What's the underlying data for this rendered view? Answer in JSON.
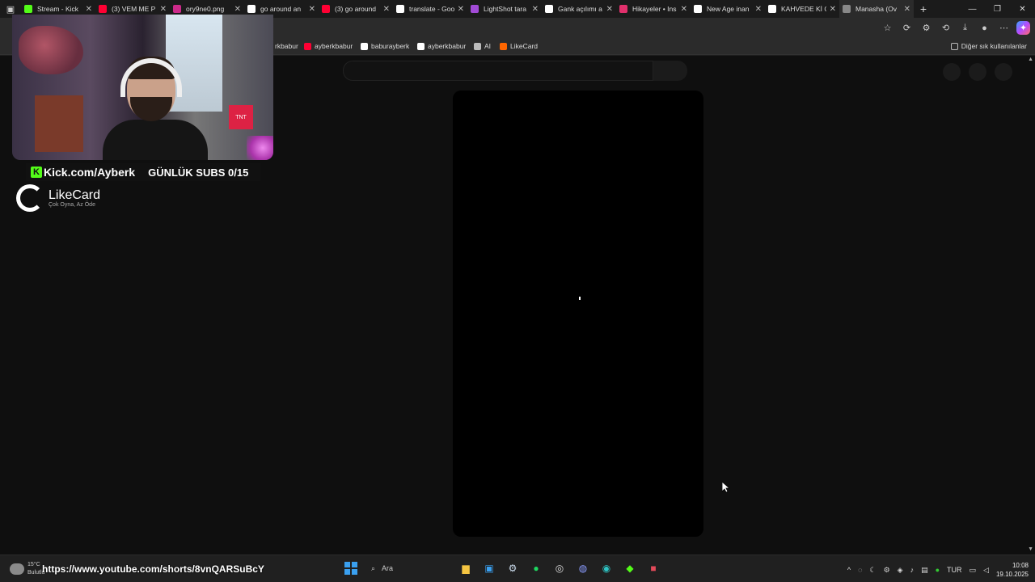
{
  "tabs": [
    {
      "label": "Stream - Kick",
      "color": "#53fc18",
      "icon": "kick-icon"
    },
    {
      "label": "(3) VEM ME P",
      "color": "#ff0033",
      "icon": "youtube-icon"
    },
    {
      "label": "ory9ne0.png",
      "color": "#cc2a8a",
      "icon": "lightshot-icon"
    },
    {
      "label": "go around an",
      "color": "#ffffff",
      "icon": "google-icon"
    },
    {
      "label": "(3) go around",
      "color": "#ff0033",
      "icon": "youtube-icon"
    },
    {
      "label": "translate - Goo",
      "color": "#ffffff",
      "icon": "google-icon"
    },
    {
      "label": "LightShot tara",
      "color": "#a24bd6",
      "icon": "lightshot-icon"
    },
    {
      "label": "Gank açılımı a",
      "color": "#ffffff",
      "icon": "globe-icon"
    },
    {
      "label": "Hikayeler • Ins",
      "color": "#e1306c",
      "icon": "instagram-icon"
    },
    {
      "label": "New Age inan",
      "color": "#ffffff",
      "icon": "globe-icon"
    },
    {
      "label": "KAHVEDE Kİ Ç",
      "color": "#ffffff",
      "icon": "google-icon"
    },
    {
      "label": "Manasha (Ov",
      "color": "#888888",
      "icon": "page-icon"
    }
  ],
  "window": {
    "new_tab": "+",
    "minimize": "—",
    "restore": "❐",
    "close": "✕"
  },
  "bookmarks": [
    {
      "label": "rkbabur",
      "icon": "bookmark-icon"
    },
    {
      "label": "ayberkbabur",
      "icon": "youtube-icon"
    },
    {
      "label": "baburayberk",
      "icon": "x-icon"
    },
    {
      "label": "ayberkbabur",
      "icon": "tiktok-icon"
    },
    {
      "label": "AI",
      "icon": "ai-icon"
    },
    {
      "label": "LikeCard",
      "icon": "likecard-icon"
    }
  ],
  "other_bookmarks": "Diğer sık kullanılanlar",
  "overlay": {
    "kick_url": "Kick.com/Ayberk",
    "subs": "GÜNLÜK SUBS 0/15",
    "likecard_name": "LikeCard",
    "likecard_tagline": "Çok Oyna, Az Öde"
  },
  "taskbar": {
    "weather_temp": "15°C",
    "weather_cond": "Bulutlu",
    "overlay_url": "https://www.youtube.com/shorts/8vnQARSuBcY",
    "search_placeholder": "Ara",
    "language": "TUR",
    "time": "10:08",
    "date": "19.10.2025"
  }
}
